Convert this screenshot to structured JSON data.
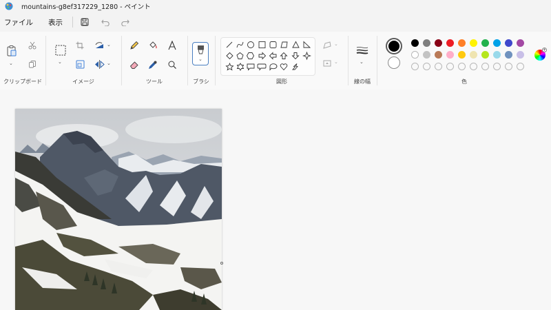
{
  "window": {
    "title": "mountains-g8ef317229_1280 - ペイント"
  },
  "menu": {
    "file": "ファイル",
    "view": "表示"
  },
  "ribbon": {
    "groups": {
      "clipboard": "クリップボード",
      "image": "イメージ",
      "tools": "ツール",
      "brush": "ブラシ",
      "shapes": "図形",
      "stroke_width": "線の幅",
      "colors": "色"
    }
  },
  "colors": {
    "primary": "#000000",
    "secondary": "#ffffff",
    "palette_row1": [
      "#000000",
      "#7f7f7f",
      "#880015",
      "#ed1c24",
      "#ff7f27",
      "#fff200",
      "#22b14c",
      "#00a2e8",
      "#3f48cc",
      "#a349a4"
    ],
    "palette_row2": [
      "#ffffff",
      "#c3c3c3",
      "#b97a57",
      "#ffaec9",
      "#ffc90e",
      "#efe4b0",
      "#b5e61d",
      "#99d9ea",
      "#7092be",
      "#c8bfe7"
    ],
    "palette_row3_empty_count": 10
  },
  "canvas": {
    "image": "snowy-mountain-landscape"
  }
}
